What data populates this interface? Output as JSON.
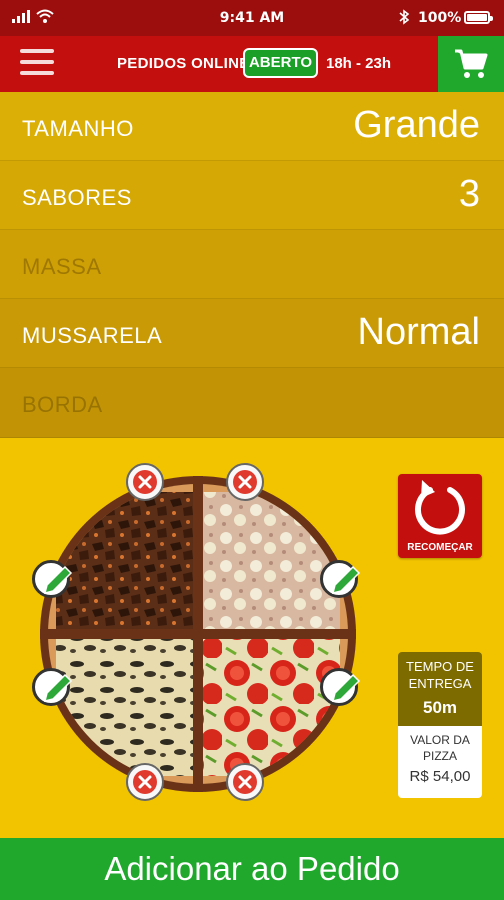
{
  "status": {
    "time": "9:41 AM",
    "battery": "100%"
  },
  "header": {
    "orders_label": "PEDIDOS ONLINE",
    "open_badge": "ABERTO",
    "hours": "18h - 23h"
  },
  "options": [
    {
      "label": "TAMANHO",
      "value": "Grande",
      "enabled": true
    },
    {
      "label": "SABORES",
      "value": "3",
      "enabled": true
    },
    {
      "label": "MASSA",
      "value": "",
      "enabled": false
    },
    {
      "label": "MUSSARELA",
      "value": "Normal",
      "enabled": true
    },
    {
      "label": "BORDA",
      "value": "",
      "enabled": false
    }
  ],
  "restart_label": "RECOMEÇAR",
  "delivery": {
    "title": "TEMPO DE ENTREGA",
    "value": "50m"
  },
  "price": {
    "title": "VALOR DA PIZZA",
    "value": "R$ 54,00"
  },
  "add_button": "Adicionar ao Pedido",
  "colors": {
    "header_red": "#c3100f",
    "status_red": "#9c0d0d",
    "green": "#1fa82c",
    "yellow": "#f2c400"
  }
}
